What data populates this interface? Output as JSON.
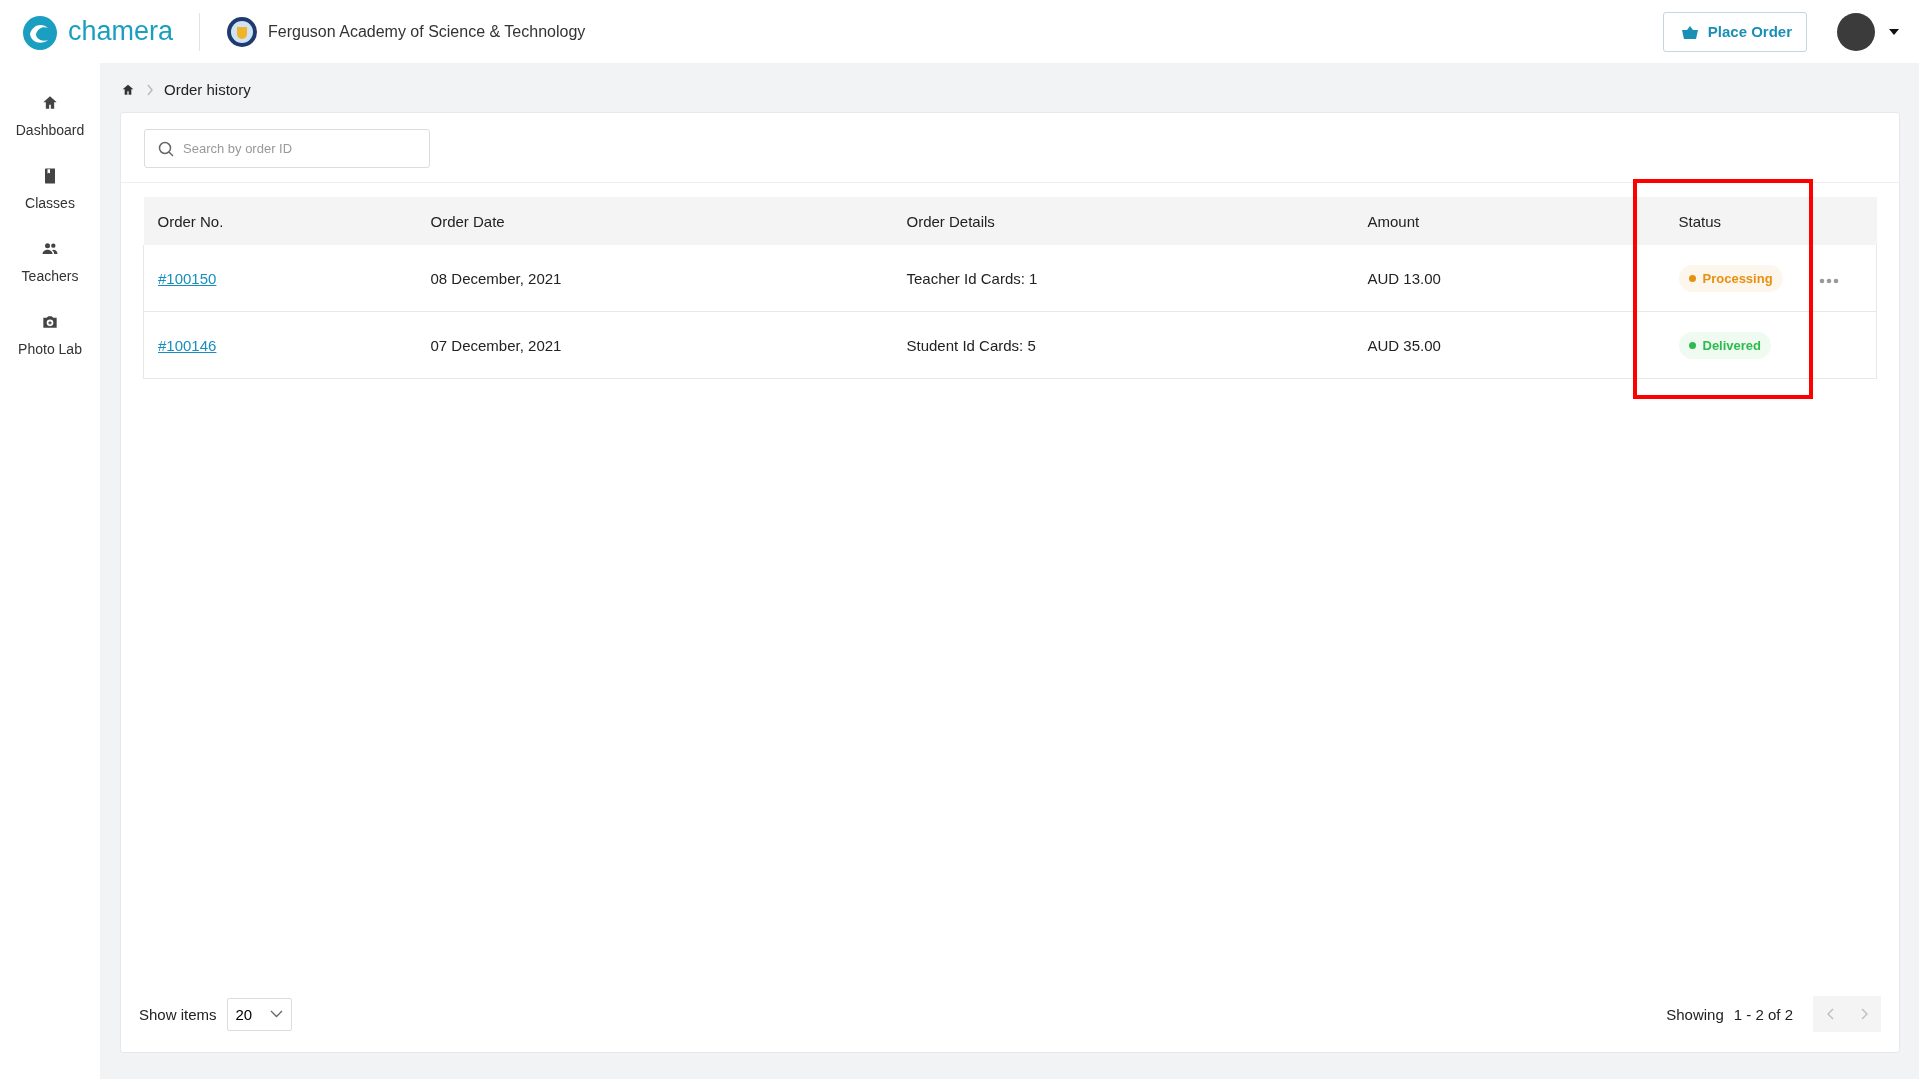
{
  "header": {
    "logo": "chamera",
    "school": "Ferguson Academy of Science & Technology",
    "place_order": "Place Order"
  },
  "sidebar": {
    "items": [
      {
        "label": "Dashboard"
      },
      {
        "label": "Classes"
      },
      {
        "label": "Teachers"
      },
      {
        "label": "Photo Lab"
      }
    ]
  },
  "breadcrumb": {
    "current": "Order history"
  },
  "search": {
    "placeholder": "Search by order ID"
  },
  "table": {
    "columns": [
      "Order No.",
      "Order Date",
      "Order Details",
      "Amount",
      "Status"
    ],
    "rows": [
      {
        "order": "#100150",
        "date": "08 December, 2021",
        "details": "Teacher Id Cards: 1",
        "amount": "AUD 13.00",
        "status": "Processing",
        "color": "#e8900f",
        "menu": true
      },
      {
        "order": "#100146",
        "date": "07 December, 2021",
        "details": "Student Id Cards: 5",
        "amount": "AUD 35.00",
        "status": "Delivered",
        "color": "#2dbb4f",
        "menu": false
      }
    ]
  },
  "footer": {
    "show_label": "Show items",
    "page_size": "20",
    "showing": "Showing",
    "range": "1 - 2 of 2"
  }
}
